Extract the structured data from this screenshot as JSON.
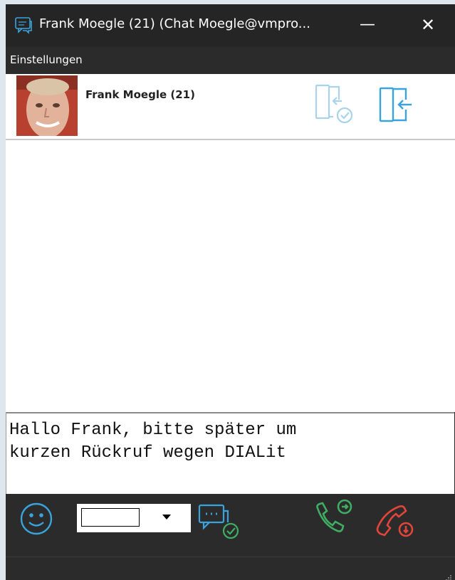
{
  "window": {
    "title": "Frank Moegle (21) (Chat Moegle@vmpro...",
    "minimize_label": "—",
    "close_label": "✕"
  },
  "menu": {
    "items": [
      {
        "label": "Einstellungen"
      }
    ]
  },
  "contact": {
    "name": "Frank Moegle (21)",
    "avatar_icon": "contact-photo",
    "actions": [
      {
        "icon": "door-enter-check-icon",
        "enabled": false
      },
      {
        "icon": "door-leave-icon",
        "enabled": true
      }
    ]
  },
  "message_input": {
    "lines": [
      "Hallo Frank, bitte später um",
      "kurzen Rückruf wegen DIALit"
    ]
  },
  "toolbar": {
    "emoji_icon": "smiley-icon",
    "font_select_value": "",
    "send_icon": "chat-send-check-icon",
    "call_icon": "phone-accept-icon",
    "hangup_icon": "phone-hangup-icon"
  },
  "colors": {
    "titlebar_bg": "#252525",
    "body_bg": "#2b2b2b",
    "accent_blue": "#3aa3db",
    "accept_green": "#3fae63",
    "hangup_red": "#e2453a"
  }
}
